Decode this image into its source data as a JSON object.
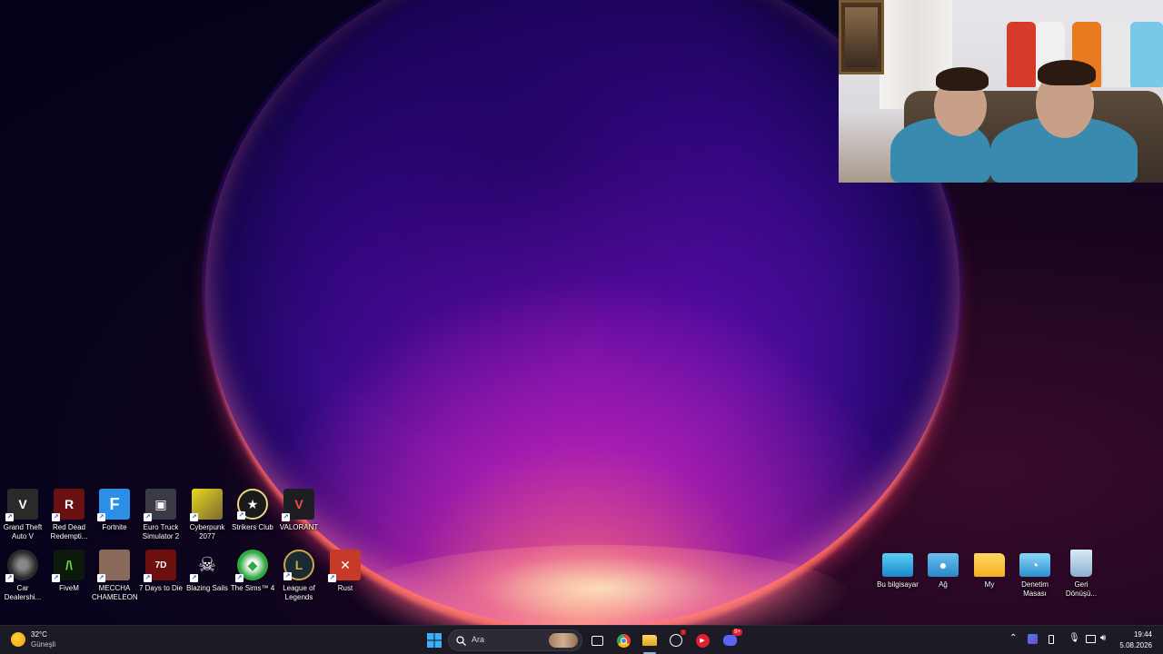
{
  "desktop_icons_row1": [
    {
      "label": "Grand Theft Auto V",
      "icon": "gta-v-icon",
      "color": "#2a2a2a"
    },
    {
      "label": "Red Dead Redempti...",
      "icon": "red-dead-icon",
      "color": "#6a1010"
    },
    {
      "label": "Fortnite",
      "icon": "fortnite-icon",
      "color": "#2b8fe8"
    },
    {
      "label": "Euro Truck Simulator 2",
      "icon": "euro-truck-icon",
      "color": "#3a3a44"
    },
    {
      "label": "Cyberpunk 2077",
      "icon": "cyberpunk-icon",
      "color": "#e8d820"
    },
    {
      "label": "Strikers Club",
      "icon": "strikers-club-icon",
      "color": "#1a1a1a"
    },
    {
      "label": "VALORANT",
      "icon": "valorant-icon",
      "color": "#1e1e22"
    }
  ],
  "desktop_icons_row2": [
    {
      "label": "Car Dealershi...",
      "icon": "car-dealership-icon",
      "color": "#2a2a2a"
    },
    {
      "label": "FiveM",
      "icon": "fivem-icon",
      "color": "#0c1a0c"
    },
    {
      "label": "MECCHA CHAMELEON",
      "icon": "meccha-chameleon-icon",
      "color": "#8a6a5a"
    },
    {
      "label": "7 Days to Die",
      "icon": "7-days-to-die-icon",
      "color": "#6a0e0e"
    },
    {
      "label": "Blazing Sails",
      "icon": "blazing-sails-icon",
      "color": "#1a1a1a"
    },
    {
      "label": "The Sims™ 4",
      "icon": "sims-4-icon",
      "color": "#2ea840"
    },
    {
      "label": "League of Legends",
      "icon": "league-of-legends-icon",
      "color": "#1a2a30"
    },
    {
      "label": "Rust",
      "icon": "rust-icon",
      "color": "#c83a28"
    }
  ],
  "system_icons": [
    {
      "label": "Bu bilgisayar",
      "icon": "this-pc-icon",
      "color": "#2aa8e0"
    },
    {
      "label": "Ağ",
      "icon": "network-icon",
      "color": "#3a9ad8"
    },
    {
      "label": "My",
      "icon": "folder-icon",
      "color": "#f2c230"
    },
    {
      "label": "Denetim Masası",
      "icon": "control-panel-icon",
      "color": "#3aa0d8"
    },
    {
      "label": "Geri Dönüşü...",
      "icon": "recycle-bin-icon",
      "color": "#a8c8e0"
    }
  ],
  "taskbar": {
    "weather_temp": "32°C",
    "weather_desc": "Güneşli",
    "search_placeholder": "Ara",
    "discord_badge": "9+",
    "time": "19:44",
    "date": "5.08.2026"
  },
  "colors": {
    "accent": "#2b8fe8",
    "taskbar_bg": "#1c1a24"
  }
}
